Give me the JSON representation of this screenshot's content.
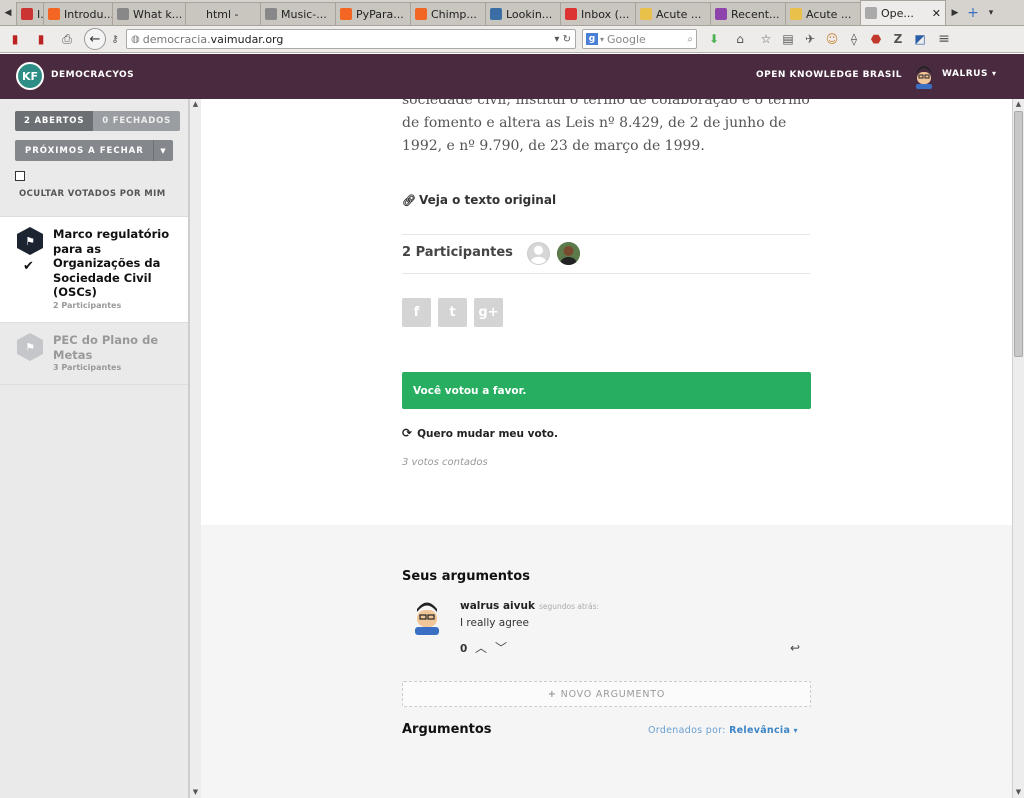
{
  "browser": {
    "tabs": [
      {
        "label": "I...",
        "color": "#c33"
      },
      {
        "label": "Introdu...",
        "color": "#f26522"
      },
      {
        "label": "What k...",
        "color": "#888"
      },
      {
        "label": "html -",
        "color": ""
      },
      {
        "label": "Music-...",
        "color": "#888"
      },
      {
        "label": "PyPara...",
        "color": "#f26522"
      },
      {
        "label": "Chimp...",
        "color": "#f26522"
      },
      {
        "label": "Lookin...",
        "color": "#3b6ea5"
      },
      {
        "label": "Inbox (...",
        "color": "#d33"
      },
      {
        "label": "Acute ...",
        "color": "#e8c04a"
      },
      {
        "label": "Recent...",
        "color": "#8e44ad"
      },
      {
        "label": "Acute ...",
        "color": "#e8c04a"
      },
      {
        "label": "Ope...",
        "color": "#aaa",
        "active": true
      }
    ],
    "url_prefix": "democracia.",
    "url_host": "vaimudar.org",
    "search_placeholder": "Google"
  },
  "header": {
    "brand": "DEMOCRACYOS",
    "org": "OPEN KNOWLEDGE BRASIL",
    "user": "WALRUS"
  },
  "sidebar": {
    "open_tab": "2 ABERTOS",
    "closed_tab": "0 FECHADOS",
    "closing_button": "PRÓXIMOS A FECHAR",
    "hide_voted": "OCULTAR VOTADOS POR MIM",
    "topics": [
      {
        "title": "Marco regulatório para as Organizações da Sociedade Civil (OSCs)",
        "count": "2 Participantes"
      },
      {
        "title": "PEC do Plano de Metas",
        "count": "3 Participantes"
      }
    ]
  },
  "main": {
    "law_text": "sociedade civil; institui o termo de colaboração e o termo de fomento e altera as Leis nº 8.429, de 2 de junho de 1992, e nº 9.790, de 23 de março de 1999.",
    "original_link": "Veja o texto original",
    "participants": "2 Participantes",
    "share": {
      "facebook": "f",
      "twitter": "t",
      "gplus": "g+"
    },
    "vote_status": "Você votou a favor.",
    "change_vote": "Quero mudar meu voto.",
    "vote_count": "3 votos contados"
  },
  "arguments": {
    "your_title": "Seus argumentos",
    "author": "walrus aivuk",
    "time": "segundos atrás:",
    "text": "I really agree",
    "score": "0",
    "new_button": "NOVO ARGUMENTO",
    "title": "Argumentos",
    "sort_label": "Ordenados por:",
    "sort_value": "Relevância"
  },
  "colors": {
    "header_bg": "#4a2a3e",
    "vote_green": "#28ae60",
    "link_blue": "#3c84c8"
  }
}
